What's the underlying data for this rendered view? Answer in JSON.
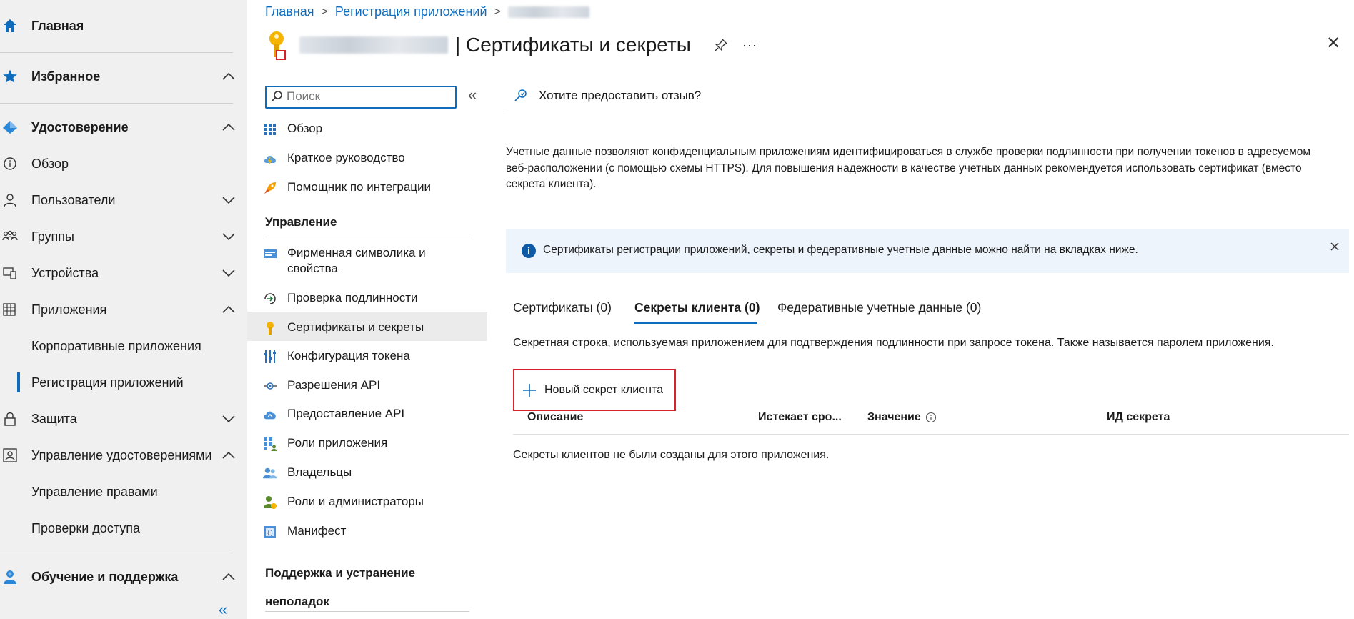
{
  "leftnav": {
    "home": "Главная",
    "favorites": "Избранное",
    "identity": "Удостоверение",
    "overview": "Обзор",
    "users": "Пользователи",
    "groups": "Группы",
    "devices": "Устройства",
    "applications": "Приложения",
    "enterprise_apps": "Корпоративные приложения",
    "app_registrations": "Регистрация приложений",
    "protection": "Защита",
    "identity_governance": "Управление удостоверениями",
    "entitlement_management": "Управление правами",
    "access_reviews": "Проверки доступа",
    "learn_support": "Обучение и поддержка",
    "collapse_glyph": "«"
  },
  "breadcrumb": {
    "home": "Главная",
    "app_registrations": "Регистрация приложений",
    "separator": ">"
  },
  "page": {
    "title": "| Сертификаты и секреты",
    "more_glyph": "···",
    "close_glyph": "✕"
  },
  "resource_menu": {
    "search_placeholder": "Поиск",
    "collapse_glyph": "«",
    "overview": "Обзор",
    "quickstart": "Краткое руководство",
    "integration_assistant": "Помощник по интеграции",
    "manage_section": "Управление",
    "branding": "Фирменная символика и свойства",
    "authentication": "Проверка подлинности",
    "certs_secrets": "Сертификаты и секреты",
    "token_config": "Конфигурация токена",
    "api_permissions": "Разрешения API",
    "expose_api": "Предоставление API",
    "app_roles": "Роли приложения",
    "owners": "Владельцы",
    "roles_admins": "Роли и администраторы",
    "manifest": "Манифест",
    "support_section": "Поддержка и устранение неполадок"
  },
  "content": {
    "feedback": "Хотите предоставить отзыв?",
    "intro": "Учетные данные позволяют конфиденциальным приложениям идентифицироваться в службе проверки подлинности при получении токенов в адресуемом веб-расположении (с помощью схемы HTTPS). Для повышения надежности в качестве учетных данных рекомендуется использовать сертификат (вместо секрета клиента).",
    "info_banner": "Сертификаты регистрации приложений, секреты и федеративные учетные данные можно найти на вкладках ниже.",
    "tabs": [
      "Сертификаты (0)",
      "Секреты клиента (0)",
      "Федеративные учетные данные (0)"
    ],
    "tab_description": "Секретная строка, используемая приложением для подтверждения подлинности при запросе токена. Также называется паролем приложения.",
    "new_secret": "Новый секрет клиента",
    "columns": {
      "description": "Описание",
      "expires": "Истекает сро...",
      "value": "Значение",
      "secret_id": "ИД секрета"
    },
    "empty_message": "Секреты клиентов не были созданы для этого приложения."
  },
  "colors": {
    "accent": "#0f6cbd",
    "highlight_red": "#d6232b",
    "nav_bg": "#f0f0f0",
    "info_bg": "#eef4fb"
  }
}
